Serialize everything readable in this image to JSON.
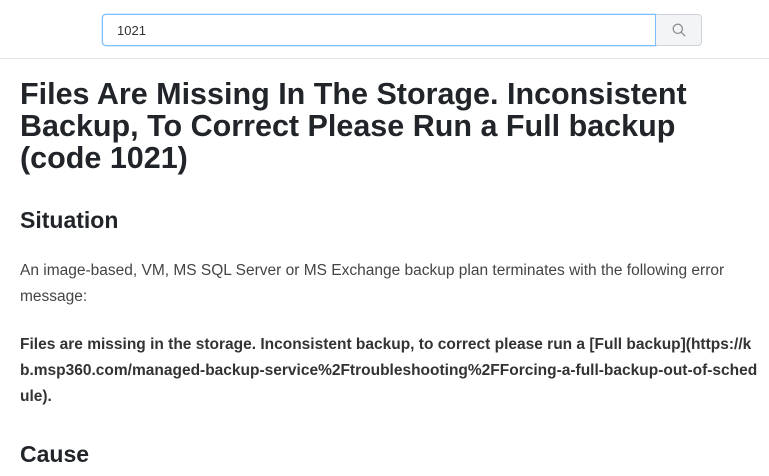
{
  "search": {
    "value": "1021",
    "icon": "search-icon"
  },
  "article": {
    "title": "Files Are Missing In The Storage. Inconsistent Backup, To Correct Please Run a Full backup (code 1021)",
    "situation_heading": "Situation",
    "situation_text": "An image-based, VM, MS SQL Server or MS Exchange backup plan terminates with the following error message:",
    "error_message": "Files are missing in the storage. Inconsistent backup, to correct please run a [Full backup](https://kb.msp360.com/managed-backup-service%2Ftroubleshooting%2FForcing-a-full-backup-out-of-schedule).",
    "cause_heading": "Cause"
  }
}
